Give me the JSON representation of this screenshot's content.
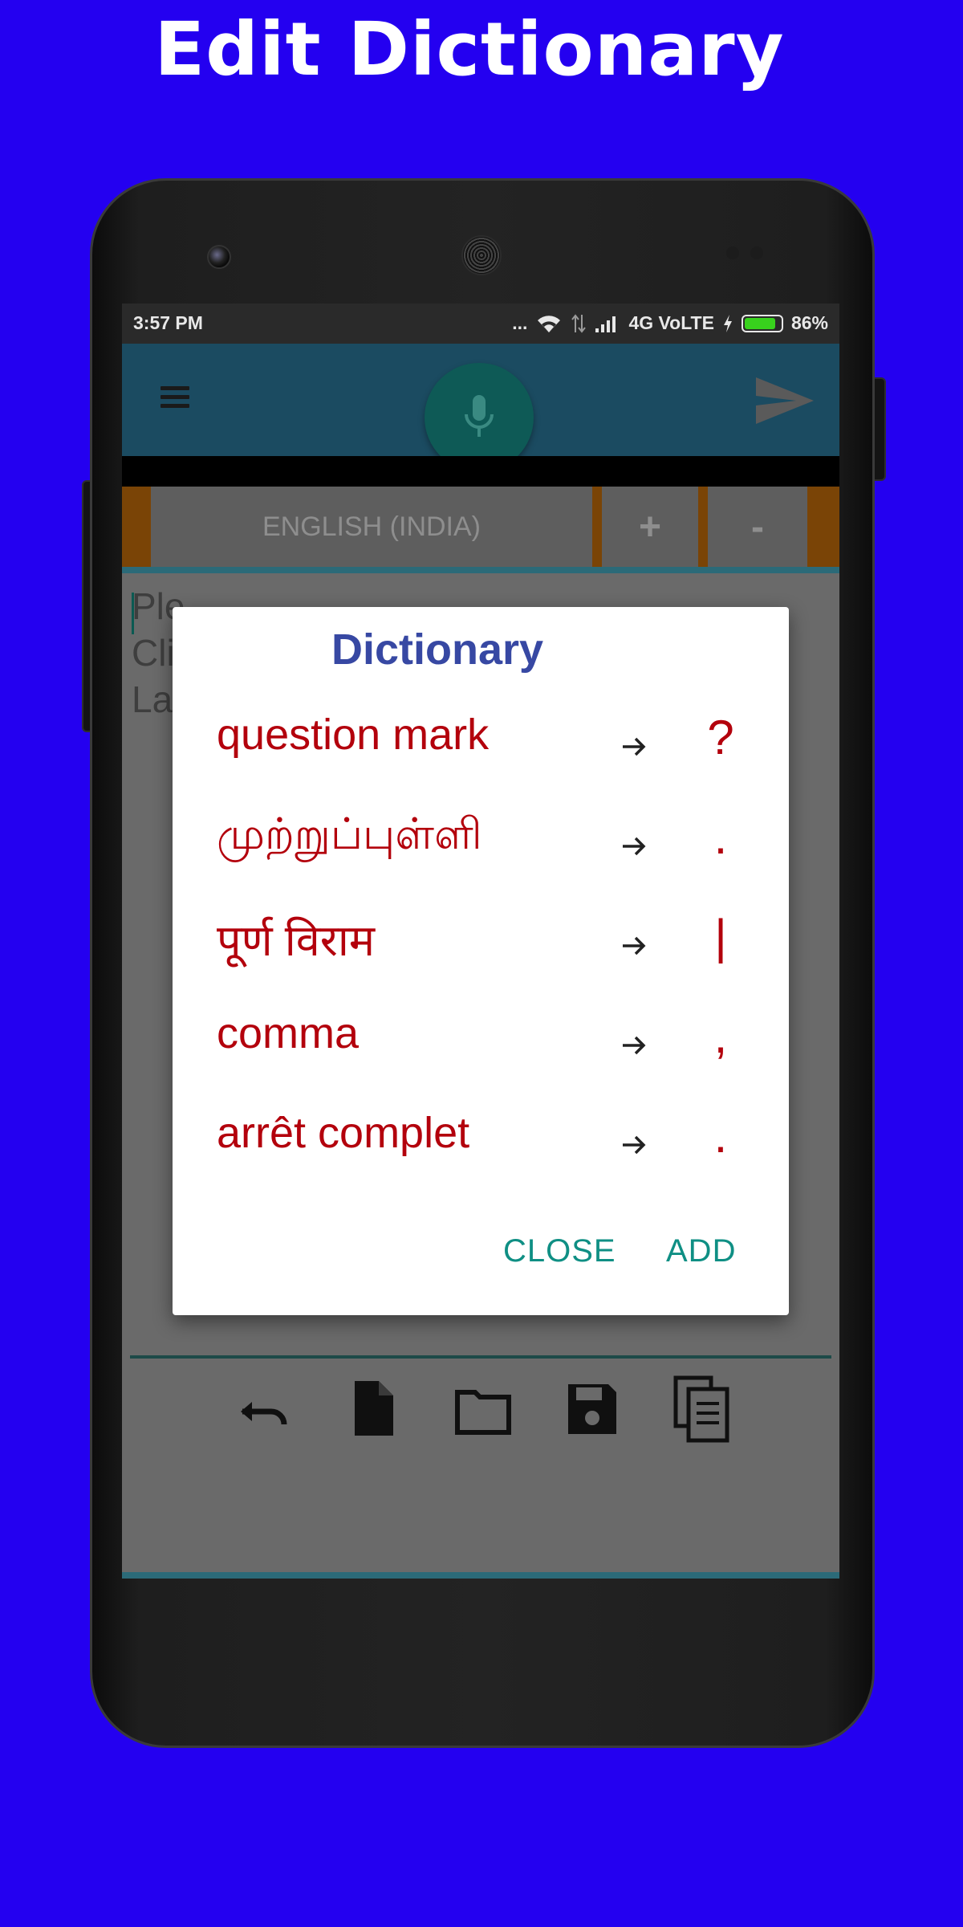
{
  "promo": {
    "title": "Edit Dictionary"
  },
  "status_bar": {
    "time": "3:57 PM",
    "dots": "...",
    "network": "4G VoLTE",
    "battery": "86%",
    "battery_level": 0.86
  },
  "app_bar": {
    "menu_icon": "hamburger-icon",
    "mic_icon": "mic-icon",
    "send_icon": "send-icon"
  },
  "language_bar": {
    "language": "ENGLISH (INDIA)",
    "plus": "+",
    "minus": "-"
  },
  "editor": {
    "hint_lines": [
      "Ple",
      "Cli",
      "La"
    ]
  },
  "dialog": {
    "title": "Dictionary",
    "entries": [
      {
        "word": "question mark",
        "symbol": "?"
      },
      {
        "word": "முற்றுப்புள்ளி",
        "symbol": "."
      },
      {
        "word": "पूर्ण विराम",
        "symbol": "|"
      },
      {
        "word": "comma",
        "symbol": ","
      },
      {
        "word": "arrêt complet",
        "symbol": "."
      }
    ],
    "close_label": "CLOSE",
    "add_label": "ADD"
  },
  "toolbar": {
    "icons": [
      "undo-icon",
      "new-file-icon",
      "folder-icon",
      "save-icon",
      "copy-icon"
    ]
  },
  "colors": {
    "background": "#2400f0",
    "app_bar": "#1b4b61",
    "accent_teal": "#0f8f84",
    "entry_text": "#b3000c",
    "dialog_title": "#3748a3",
    "battery": "#38d21d"
  }
}
